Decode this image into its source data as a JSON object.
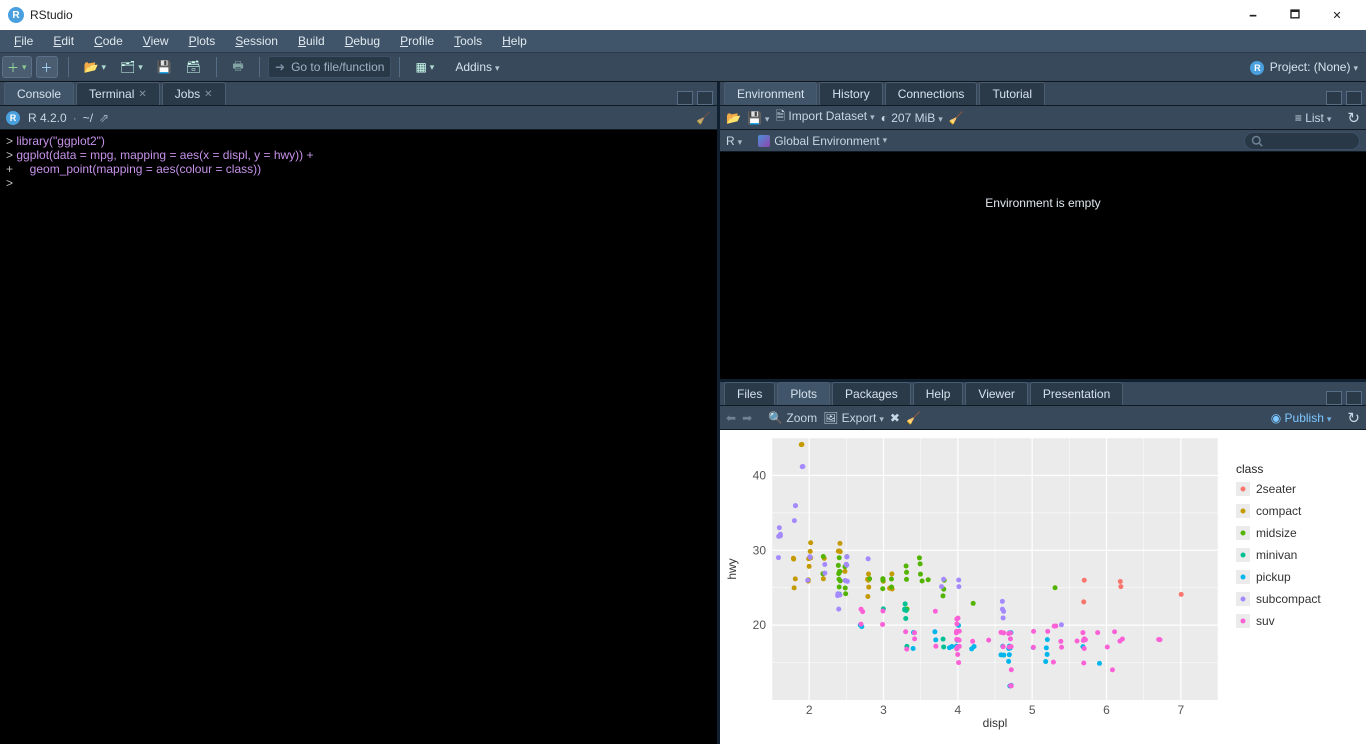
{
  "window": {
    "title": "RStudio"
  },
  "menubar": [
    "File",
    "Edit",
    "Code",
    "View",
    "Plots",
    "Session",
    "Build",
    "Debug",
    "Profile",
    "Tools",
    "Help"
  ],
  "main_toolbar": {
    "goto_placeholder": "Go to file/function",
    "addins_label": "Addins",
    "project_label": "Project: (None)"
  },
  "left_tabs": {
    "console": "Console",
    "terminal": "Terminal",
    "jobs": "Jobs"
  },
  "console": {
    "header_version": "R 4.2.0",
    "header_path": "~/",
    "lines": [
      {
        "prompt": ">",
        "text": "library(\"ggplot2\")"
      },
      {
        "prompt": ">",
        "text": "ggplot(data = mpg, mapping = aes(x = displ, y = hwy)) +"
      },
      {
        "prompt": "+",
        "text": "    geom_point(mapping = aes(colour = class))"
      },
      {
        "prompt": ">",
        "text": ""
      }
    ]
  },
  "env_tabs": [
    "Environment",
    "History",
    "Connections",
    "Tutorial"
  ],
  "env_toolbar": {
    "import_label": "Import Dataset",
    "mem_label": "207 MiB",
    "view_label": "List",
    "scope_label": "Global Environment",
    "r_label": "R"
  },
  "env_body": {
    "empty_text": "Environment is empty"
  },
  "plots_tabs": [
    "Files",
    "Plots",
    "Packages",
    "Help",
    "Viewer",
    "Presentation"
  ],
  "plots_toolbar": {
    "zoom": "Zoom",
    "export": "Export",
    "publish": "Publish"
  },
  "chart_data": {
    "type": "scatter",
    "xlabel": "displ",
    "ylabel": "hwy",
    "xlim": [
      1.5,
      7.5
    ],
    "ylim": [
      10,
      45
    ],
    "xticks": [
      2,
      3,
      4,
      5,
      6,
      7
    ],
    "yticks": [
      20,
      30,
      40
    ],
    "legend_title": "class",
    "colors": {
      "2seater": "#F8766D",
      "compact": "#C49A00",
      "midsize": "#53B400",
      "minivan": "#00C094",
      "pickup": "#00B6EB",
      "subcompact": "#A58AFF",
      "suv": "#FB61D7"
    },
    "series": [
      {
        "name": "2seater",
        "points": [
          [
            5.7,
            26
          ],
          [
            5.7,
            23
          ],
          [
            6.2,
            26
          ],
          [
            6.2,
            25
          ],
          [
            7.0,
            24
          ]
        ]
      },
      {
        "name": "compact",
        "points": [
          [
            1.8,
            29
          ],
          [
            1.8,
            29
          ],
          [
            2.0,
            31
          ],
          [
            2.0,
            30
          ],
          [
            2.8,
            26
          ],
          [
            2.8,
            26
          ],
          [
            3.1,
            27
          ],
          [
            1.8,
            26
          ],
          [
            1.8,
            25
          ],
          [
            2.0,
            28
          ],
          [
            2.0,
            29
          ],
          [
            2.8,
            27
          ],
          [
            2.8,
            25
          ],
          [
            3.1,
            25
          ],
          [
            3.1,
            25
          ],
          [
            2.4,
            30
          ],
          [
            2.4,
            30
          ],
          [
            2.5,
            26
          ],
          [
            2.5,
            27
          ],
          [
            2.2,
            27
          ],
          [
            2.2,
            29
          ],
          [
            2.4,
            31
          ],
          [
            2.4,
            30
          ],
          [
            3.0,
            26
          ],
          [
            2.2,
            26
          ],
          [
            2.4,
            27
          ],
          [
            2.0,
            26
          ],
          [
            2.0,
            29
          ],
          [
            1.9,
            44
          ],
          [
            2.0,
            29
          ],
          [
            2.0,
            29
          ],
          [
            2.8,
            24
          ],
          [
            1.9,
            44
          ],
          [
            2.0,
            26
          ]
        ]
      },
      {
        "name": "midsize",
        "points": [
          [
            2.8,
            26
          ],
          [
            3.1,
            25
          ],
          [
            4.2,
            23
          ],
          [
            2.4,
            27
          ],
          [
            2.4,
            27
          ],
          [
            3.1,
            26
          ],
          [
            3.5,
            29
          ],
          [
            3.6,
            26
          ],
          [
            2.4,
            26
          ],
          [
            2.4,
            26
          ],
          [
            2.4,
            27
          ],
          [
            2.4,
            25
          ],
          [
            2.5,
            25
          ],
          [
            2.5,
            24
          ],
          [
            3.3,
            22
          ],
          [
            2.5,
            28
          ],
          [
            2.5,
            29
          ],
          [
            3.5,
            26
          ],
          [
            3.5,
            28
          ],
          [
            3.0,
            26
          ],
          [
            3.0,
            25
          ],
          [
            3.3,
            26
          ],
          [
            3.3,
            28
          ],
          [
            3.3,
            27
          ],
          [
            3.8,
            26
          ],
          [
            3.8,
            25
          ],
          [
            3.8,
            24
          ],
          [
            5.3,
            25
          ],
          [
            2.2,
            27
          ],
          [
            2.2,
            29
          ],
          [
            2.4,
            28
          ],
          [
            2.4,
            29
          ],
          [
            3.0,
            26
          ],
          [
            3.0,
            26
          ],
          [
            3.5,
            27
          ]
        ]
      },
      {
        "name": "minivan",
        "points": [
          [
            2.4,
            24
          ],
          [
            3.0,
            22
          ],
          [
            3.3,
            22
          ],
          [
            3.3,
            22
          ],
          [
            3.3,
            17
          ],
          [
            3.3,
            22
          ],
          [
            3.3,
            21
          ],
          [
            3.3,
            23
          ],
          [
            3.8,
            18
          ],
          [
            3.8,
            17
          ],
          [
            4.0,
            17
          ]
        ]
      },
      {
        "name": "pickup",
        "points": [
          [
            3.7,
            19
          ],
          [
            3.7,
            18
          ],
          [
            3.9,
            17
          ],
          [
            3.9,
            17
          ],
          [
            4.7,
            19
          ],
          [
            4.7,
            19
          ],
          [
            4.7,
            12
          ],
          [
            5.2,
            17
          ],
          [
            5.2,
            15
          ],
          [
            5.7,
            17
          ],
          [
            5.9,
            15
          ],
          [
            4.7,
            17
          ],
          [
            4.7,
            17
          ],
          [
            4.7,
            16
          ],
          [
            4.7,
            12
          ],
          [
            4.7,
            17
          ],
          [
            4.7,
            15
          ],
          [
            5.2,
            16
          ],
          [
            5.2,
            18
          ],
          [
            2.7,
            20
          ],
          [
            2.7,
            20
          ],
          [
            3.4,
            19
          ],
          [
            3.4,
            17
          ],
          [
            4.0,
            20
          ],
          [
            4.0,
            17
          ],
          [
            4.0,
            17
          ],
          [
            4.0,
            18
          ],
          [
            4.6,
            17
          ],
          [
            5.0,
            17
          ],
          [
            4.2,
            17
          ],
          [
            4.2,
            17
          ],
          [
            4.6,
            16
          ],
          [
            4.6,
            16
          ]
        ]
      },
      {
        "name": "subcompact",
        "points": [
          [
            3.8,
            26
          ],
          [
            3.8,
            25
          ],
          [
            4.0,
            26
          ],
          [
            4.0,
            25
          ],
          [
            4.6,
            21
          ],
          [
            4.6,
            22
          ],
          [
            4.6,
            23
          ],
          [
            4.6,
            22
          ],
          [
            5.4,
            20
          ],
          [
            1.6,
            33
          ],
          [
            1.6,
            32
          ],
          [
            1.6,
            32
          ],
          [
            1.6,
            29
          ],
          [
            1.6,
            32
          ],
          [
            1.8,
            34
          ],
          [
            1.8,
            36
          ],
          [
            1.8,
            36
          ],
          [
            2.0,
            29
          ],
          [
            2.4,
            24
          ],
          [
            2.4,
            24
          ],
          [
            2.4,
            24
          ],
          [
            2.4,
            22
          ],
          [
            2.5,
            26
          ],
          [
            2.5,
            26
          ],
          [
            2.2,
            28
          ],
          [
            2.2,
            27
          ],
          [
            2.5,
            29
          ],
          [
            2.5,
            29
          ],
          [
            1.9,
            41
          ],
          [
            1.9,
            41
          ],
          [
            2.0,
            29
          ],
          [
            2.0,
            26
          ],
          [
            2.5,
            28
          ],
          [
            2.5,
            28
          ],
          [
            2.8,
            29
          ]
        ]
      },
      {
        "name": "suv",
        "points": [
          [
            5.3,
            20
          ],
          [
            5.3,
            15
          ],
          [
            5.3,
            20
          ],
          [
            5.7,
            17
          ],
          [
            6.0,
            17
          ],
          [
            5.7,
            18
          ],
          [
            5.7,
            18
          ],
          [
            6.2,
            18
          ],
          [
            6.2,
            18
          ],
          [
            6.7,
            18
          ],
          [
            6.7,
            18
          ],
          [
            2.7,
            22
          ],
          [
            2.7,
            22
          ],
          [
            2.7,
            20
          ],
          [
            3.0,
            22
          ],
          [
            3.7,
            17
          ],
          [
            4.0,
            17
          ],
          [
            4.7,
            12
          ],
          [
            4.7,
            17
          ],
          [
            4.7,
            12
          ],
          [
            5.2,
            19
          ],
          [
            5.7,
            18
          ],
          [
            5.9,
            19
          ],
          [
            4.7,
            19
          ],
          [
            4.7,
            14
          ],
          [
            5.7,
            15
          ],
          [
            6.1,
            14
          ],
          [
            4.0,
            19
          ],
          [
            4.0,
            18
          ],
          [
            4.0,
            21
          ],
          [
            4.0,
            21
          ],
          [
            4.6,
            19
          ],
          [
            5.0,
            17
          ],
          [
            3.3,
            17
          ],
          [
            3.3,
            19
          ],
          [
            4.0,
            18
          ],
          [
            5.6,
            18
          ],
          [
            3.4,
            19
          ],
          [
            3.4,
            18
          ],
          [
            4.0,
            16
          ],
          [
            4.0,
            20
          ],
          [
            4.0,
            17
          ],
          [
            4.0,
            19
          ],
          [
            4.0,
            18
          ],
          [
            3.0,
            20
          ],
          [
            3.7,
            22
          ],
          [
            4.0,
            17
          ],
          [
            4.7,
            17
          ],
          [
            4.7,
            19
          ],
          [
            4.7,
            18
          ],
          [
            5.7,
            19
          ],
          [
            6.1,
            19
          ],
          [
            4.0,
            15
          ],
          [
            4.2,
            18
          ],
          [
            4.4,
            18
          ],
          [
            4.6,
            17
          ],
          [
            5.4,
            17
          ],
          [
            5.4,
            18
          ],
          [
            4.0,
            19
          ],
          [
            4.0,
            19
          ],
          [
            4.6,
            19
          ],
          [
            5.0,
            19
          ]
        ]
      }
    ]
  }
}
